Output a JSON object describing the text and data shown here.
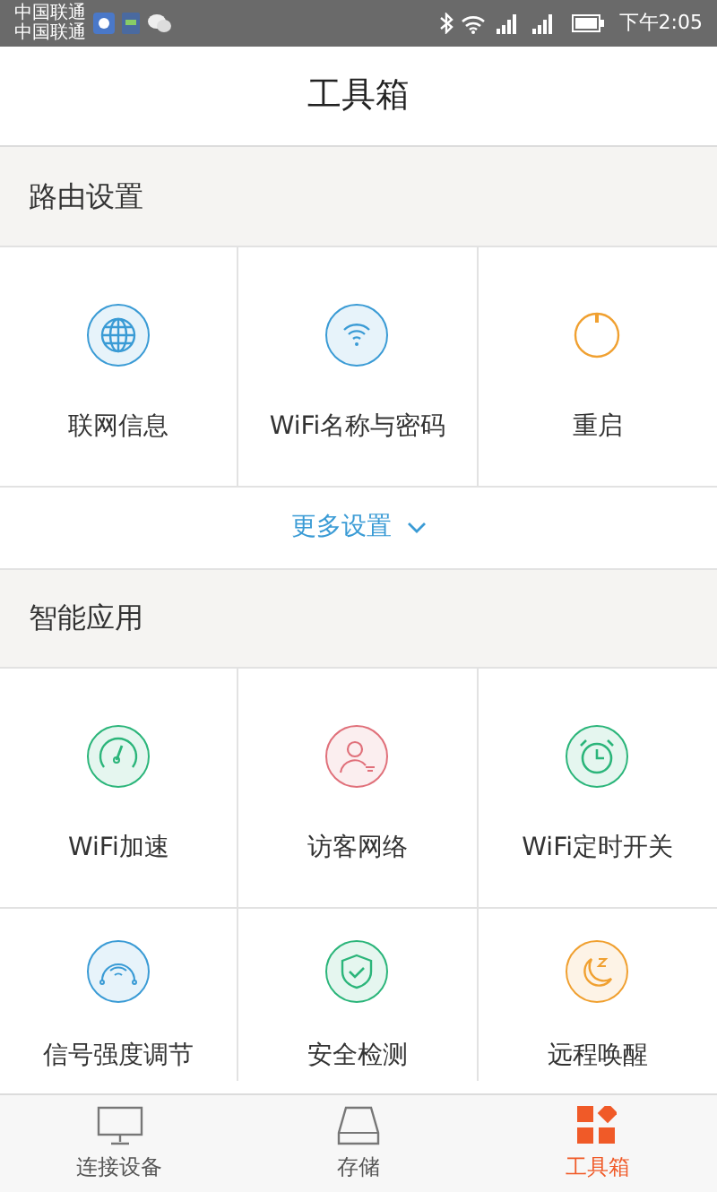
{
  "status_bar": {
    "carriers": [
      "中国联通",
      "中国联通"
    ],
    "time": "下午2:05"
  },
  "title": "工具箱",
  "sections": [
    {
      "title": "路由设置",
      "tools": [
        {
          "label": "联网信息"
        },
        {
          "label": "WiFi名称与密码"
        },
        {
          "label": "重启"
        }
      ],
      "more": "更多设置"
    },
    {
      "title": "智能应用",
      "tools": [
        {
          "label": "WiFi加速"
        },
        {
          "label": "访客网络"
        },
        {
          "label": "WiFi定时开关"
        },
        {
          "label": "信号强度调节"
        },
        {
          "label": "安全检测"
        },
        {
          "label": "远程唤醒"
        }
      ]
    }
  ],
  "nav": [
    {
      "label": "连接设备",
      "selected": false
    },
    {
      "label": "存储",
      "selected": false
    },
    {
      "label": "工具箱",
      "selected": true
    }
  ]
}
